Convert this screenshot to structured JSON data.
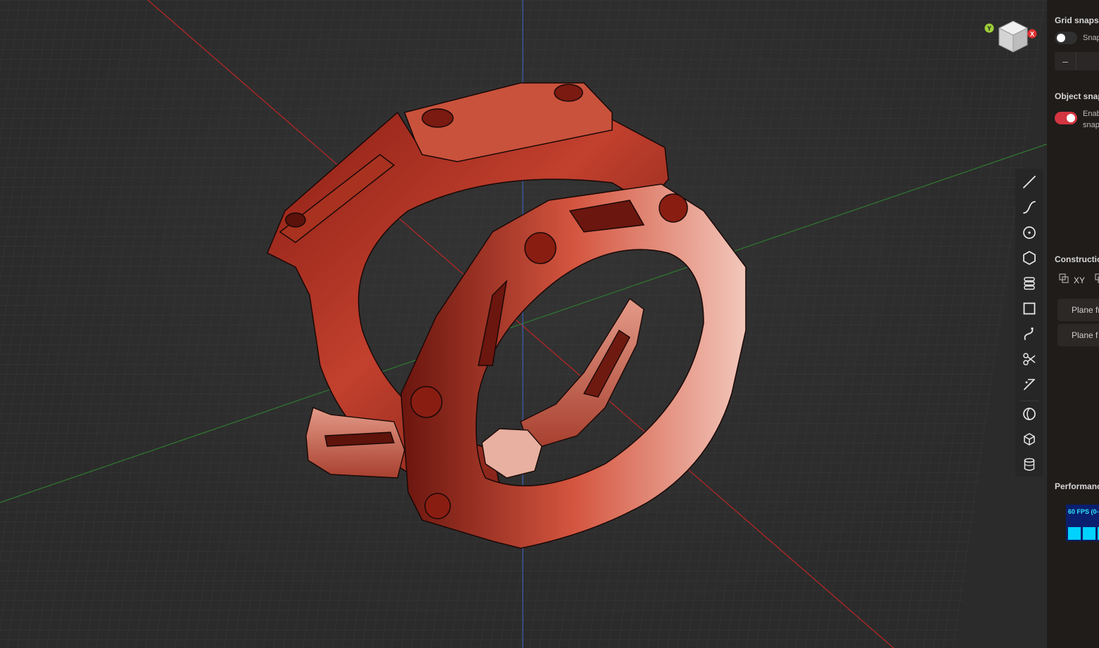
{
  "viewport": {
    "view_cube": {
      "axis_y_label": "Y",
      "axis_x_label": "X",
      "icon": "view-cube-icon"
    },
    "model_color": "#c0392b"
  },
  "toolbar": {
    "tools": [
      {
        "name": "line-tool",
        "icon": "line-icon"
      },
      {
        "name": "spline-tool",
        "icon": "curve-icon"
      },
      {
        "name": "circle-tool",
        "icon": "circle-dot-icon"
      },
      {
        "name": "polygon-tool",
        "icon": "hexagon-icon"
      },
      {
        "name": "layers-tool",
        "icon": "stack-icon"
      },
      {
        "name": "rectangle-tool",
        "icon": "square-icon"
      },
      {
        "name": "curve-edit-tool",
        "icon": "s-curve-icon"
      },
      {
        "name": "trim-tool",
        "icon": "scissors-icon"
      },
      {
        "name": "extend-tool",
        "icon": "extend-icon"
      },
      {
        "name": "revolve-tool",
        "icon": "revolve-icon"
      },
      {
        "name": "box-tool",
        "icon": "cube-icon"
      },
      {
        "name": "cylinder-tool",
        "icon": "cylinder-icon"
      }
    ]
  },
  "sidepanel": {
    "grid_snaps": {
      "title": "Grid snaps",
      "toggle_label": "Snap",
      "enabled": false,
      "stepper_minus": "–"
    },
    "object_snaps": {
      "title": "Object snap",
      "toggle_label_line1": "Enab",
      "toggle_label_line2": "snap",
      "enabled": true
    },
    "construction": {
      "title": "Constructio",
      "plane_label": "XY",
      "btn_plane_1": "Plane fr",
      "btn_plane_2": "Plane f"
    },
    "performance": {
      "title": "Performanc",
      "fps_label": "60 FPS (0-"
    }
  }
}
